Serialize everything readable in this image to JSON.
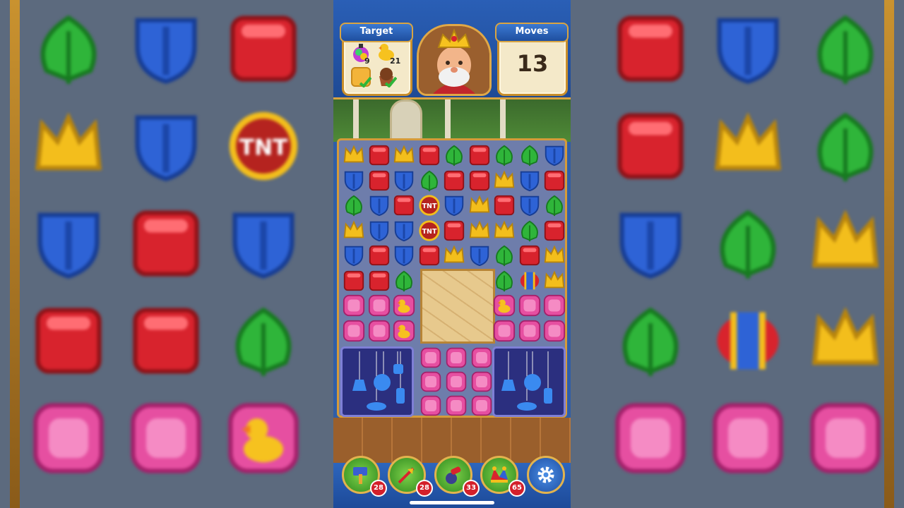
{
  "header": {
    "target_label": "Target",
    "moves_label": "Moves",
    "moves_value": "13"
  },
  "targets": [
    {
      "icon": "gem-bottle-icon",
      "count": "9"
    },
    {
      "icon": "duck-icon",
      "count": "21"
    },
    {
      "icon": "sand-tile-icon",
      "count": "done"
    },
    {
      "icon": "cupcake-icon",
      "count": "done"
    }
  ],
  "boosters": [
    {
      "icon": "hammer-icon",
      "count": "28"
    },
    {
      "icon": "arrow-icon",
      "count": "28"
    },
    {
      "icon": "cannon-icon",
      "count": "33"
    },
    {
      "icon": "jester-hat-icon",
      "count": "65"
    }
  ],
  "colors": {
    "red": "#d8232d",
    "blue": "#2e63d6",
    "green": "#2fb53a",
    "yellow": "#f3be1c",
    "pink": "#e64fa1"
  },
  "board": [
    [
      "yellow",
      "red",
      "yellow",
      "red",
      "green",
      "red",
      "green",
      "green",
      "blue"
    ],
    [
      "blue",
      "red",
      "blue",
      "green",
      "red",
      "red",
      "yellow",
      "blue",
      "red"
    ],
    [
      "green",
      "blue",
      "red",
      "tnt",
      "blue",
      "yellow",
      "red",
      "blue",
      "green"
    ],
    [
      "yellow",
      "blue",
      "blue",
      "tnt",
      "red",
      "yellow",
      "yellow",
      "green",
      "red"
    ],
    [
      "blue",
      "red",
      "blue",
      "red",
      "yellow",
      "blue",
      "green",
      "red",
      "yellow"
    ],
    [
      "red",
      "red",
      "green",
      "",
      "",
      "",
      "green",
      "rocket",
      "yellow"
    ],
    [
      "pink",
      "pink",
      "duck",
      "",
      "",
      "",
      "duck",
      "pink",
      "pink"
    ],
    [
      "pink",
      "pink",
      "duck",
      "",
      "",
      "",
      "pink",
      "pink",
      "pink"
    ]
  ]
}
